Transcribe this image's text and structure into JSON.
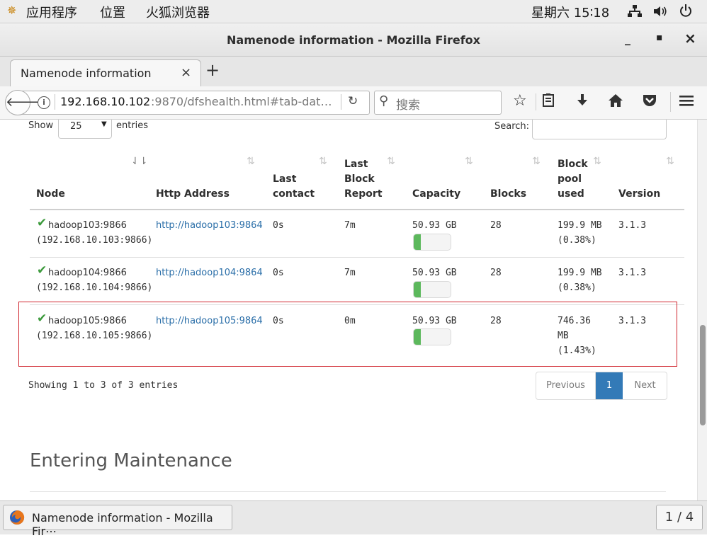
{
  "topbar": {
    "apps": "应用程序",
    "places": "位置",
    "firefox": "火狐浏览器",
    "clock": "星期六 15∶18"
  },
  "window": {
    "title": "Namenode information - Mozilla Firefox",
    "minimize": "_",
    "maximize": "▪",
    "close": "×"
  },
  "tabs": [
    {
      "label": "Namenode information",
      "close": "×"
    }
  ],
  "new_tab": "+",
  "nav": {
    "url_host": "192.168.10.102",
    "url_rest": ":9870/dfshealth.html#tab-dat…",
    "search_placeholder": "搜索"
  },
  "table": {
    "show_label": "Show",
    "entries_label": "entries",
    "page_size": "25",
    "search_label": "Search:",
    "columns": {
      "node": "Node",
      "http1": "Http",
      "http2": "Address",
      "last_contact1": "Last",
      "last_contact2": "contact",
      "last_block1": "Last",
      "last_block2": "Block",
      "last_block3": "Report",
      "capacity": "Capacity",
      "blocks": "Blocks",
      "pool1": "Block",
      "pool2": "pool",
      "pool3": "used",
      "version": "Version"
    },
    "rows": [
      {
        "node": "hadoop103:9866",
        "node_ip": "(192.168.10.103:9866)",
        "http": "http://hadoop103:9864",
        "last_contact": "0s",
        "last_block": "7m",
        "capacity": "50.93 GB",
        "capacity_used_fraction": 0.2,
        "blocks": "28",
        "pool_l1": "199.9 MB",
        "pool_l2": "(0.38%)",
        "pool_l3": "",
        "version": "3.1.3"
      },
      {
        "node": "hadoop104:9866",
        "node_ip": "(192.168.10.104:9866)",
        "http": "http://hadoop104:9864",
        "last_contact": "0s",
        "last_block": "7m",
        "capacity": "50.93 GB",
        "capacity_used_fraction": 0.2,
        "blocks": "28",
        "pool_l1": "199.9 MB",
        "pool_l2": "(0.38%)",
        "pool_l3": "",
        "version": "3.1.3"
      },
      {
        "node": "hadoop105:9866",
        "node_ip": "(192.168.10.105:9866)",
        "http": "http://hadoop105:9864",
        "last_contact": "0s",
        "last_block": "0m",
        "capacity": "50.93 GB",
        "capacity_used_fraction": 0.2,
        "blocks": "28",
        "pool_l1": "746.36",
        "pool_l2": "MB",
        "pool_l3": "(1.43%)",
        "version": "3.1.3"
      }
    ],
    "info": "Showing 1 to 3 of 3 entries",
    "pagination": {
      "previous": "Previous",
      "current": "1",
      "next": "Next"
    }
  },
  "section_heading": "Entering Maintenance",
  "taskbar": {
    "window_label": "Namenode information - Mozilla Fir⋯",
    "workspace": "1 / 4"
  },
  "colors": {
    "highlight": "#d0262f",
    "accent_blue": "#337ab7",
    "link": "#2a6ea8",
    "progress_green": "#5cb85c",
    "check_green": "#3c9a3c"
  }
}
